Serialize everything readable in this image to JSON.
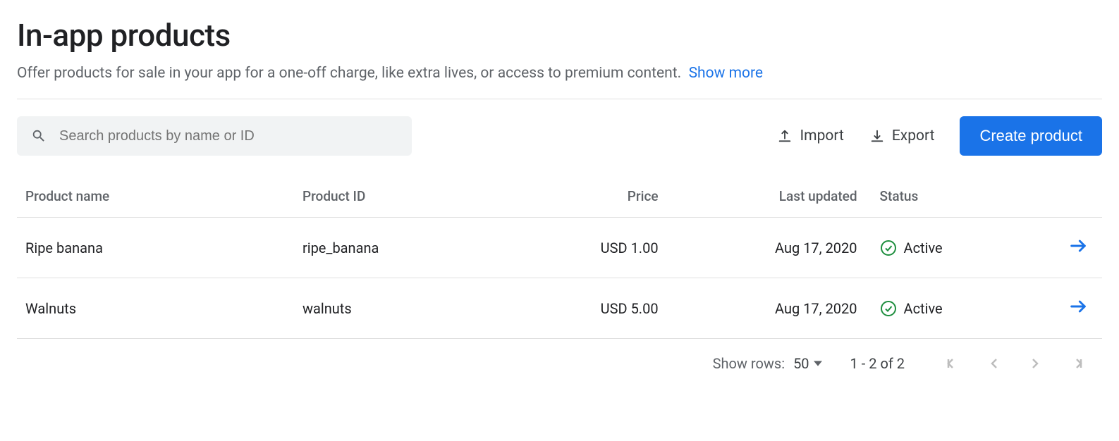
{
  "header": {
    "title": "In-app products",
    "subtitle": "Offer products for sale in your app for a one-off charge, like extra lives, or access to premium content.",
    "show_more": "Show more"
  },
  "toolbar": {
    "search_placeholder": "Search products by name or ID",
    "import_label": "Import",
    "export_label": "Export",
    "create_label": "Create product"
  },
  "table": {
    "columns": {
      "name": "Product name",
      "id": "Product ID",
      "price": "Price",
      "updated": "Last updated",
      "status": "Status"
    },
    "rows": [
      {
        "name": "Ripe banana",
        "id": "ripe_banana",
        "price": "USD 1.00",
        "updated": "Aug 17, 2020",
        "status": "Active"
      },
      {
        "name": "Walnuts",
        "id": "walnuts",
        "price": "USD 5.00",
        "updated": "Aug 17, 2020",
        "status": "Active"
      }
    ]
  },
  "pagination": {
    "show_rows_label": "Show rows:",
    "rows_per_page": "50",
    "range": "1 - 2 of 2"
  }
}
